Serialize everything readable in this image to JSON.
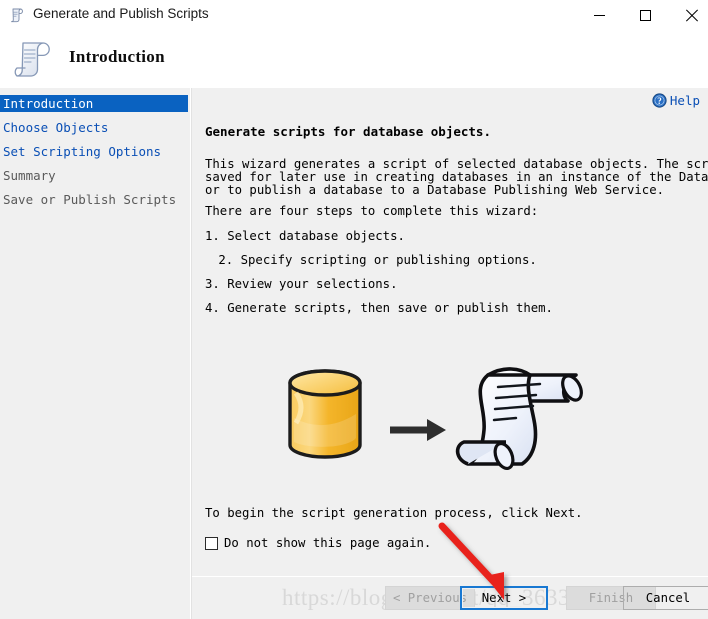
{
  "window": {
    "title": "Generate and Publish Scripts",
    "title_icon": "script-scroll-icon",
    "controls": {
      "minimize": "minimize-icon",
      "maximize": "maximize-icon",
      "close": "close-icon"
    }
  },
  "header": {
    "icon": "script-scroll-icon",
    "title": "Introduction"
  },
  "sidebar": {
    "items": [
      {
        "label": "Introduction",
        "state": "active"
      },
      {
        "label": "Choose Objects",
        "state": "link"
      },
      {
        "label": "Set Scripting Options",
        "state": "link"
      },
      {
        "label": "Summary",
        "state": "dim"
      },
      {
        "label": "Save or Publish Scripts",
        "state": "dim"
      }
    ]
  },
  "content": {
    "help": {
      "label": "Help",
      "icon": "help-question-icon"
    },
    "heading": "Generate scripts for database objects.",
    "intro_paragraph": "This wizard generates a script of selected database objects. The scripts can be\nsaved for later use in creating databases in an instance of the Database Engine,\nor to publish a database to a Database Publishing Web Service.",
    "steps_intro": "There are four steps to complete this wizard:",
    "steps": [
      "1. Select database objects.",
      " 2. Specify scripting or publishing options.",
      "3. Review your selections.",
      "4. Generate scripts, then save or publish them."
    ],
    "illustration": {
      "source_icon": "database-cylinder-icon",
      "arrow_icon": "right-arrow-icon",
      "target_icon": "script-scroll-illustration"
    },
    "begin_text": "To begin the script generation process, click Next.",
    "checkbox": {
      "label": "Do not show this page again.",
      "checked": false
    }
  },
  "footer": {
    "watermark": "https://blog.csdn.net/qq_36339828",
    "buttons": [
      {
        "label": "< Previous",
        "state": "disabled"
      },
      {
        "label": "Next >",
        "state": "focused"
      },
      {
        "label": "Finish",
        "state": "disabled"
      },
      {
        "label": "Cancel",
        "state": "enabled"
      }
    ]
  },
  "annotation": {
    "arrow_color": "#e8241c",
    "points_to": "Next >"
  },
  "colors": {
    "accent_blue": "#0a62c1",
    "link_blue": "#0a4fb5",
    "focus_border": "#1878d2",
    "window_bg": "#f0f0f0",
    "titlebar_bg": "#ffffff",
    "db_cylinder": "#f5b924"
  }
}
